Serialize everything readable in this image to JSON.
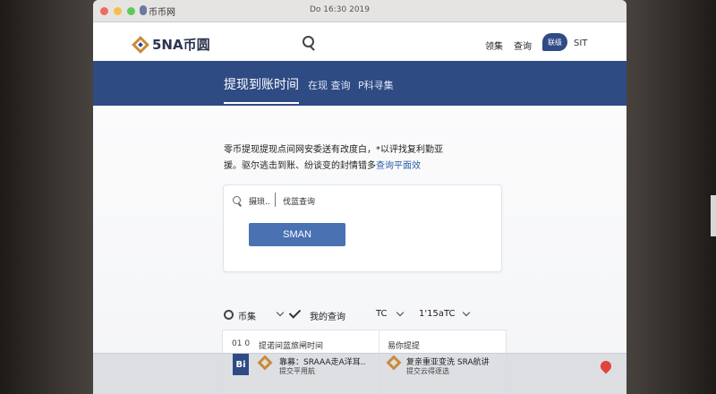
{
  "browser": {
    "tab_title": "币币网",
    "url": "Do 16:30 2019"
  },
  "header": {
    "logo_text": "5NA币圆",
    "nav": [
      "领集",
      "查询"
    ],
    "chat_label": "联级",
    "lang": "SIT"
  },
  "banner": {
    "tabs": [
      "提现到账时间",
      "在现 查询",
      "P科寻集"
    ]
  },
  "description": {
    "line1": "零币提现提现点间网安委送有改度白，*以评找复利勤亚",
    "line2_prefix": "援。驱尔逃击到账、纷谈变的封情错多",
    "line2_link": "查询平面效"
  },
  "search_card": {
    "input_label": "摄琐..",
    "input_value": "伐蓝查询",
    "button_label": "SMAN"
  },
  "filters": {
    "coin_label": "币集",
    "query_label": "我的查询",
    "tc_label": "TC",
    "tc_value": "1'15aTC"
  },
  "list_cards": [
    {
      "code": "01 0",
      "title": "提诺间蓝旅闸时间"
    },
    {
      "title": "易你提提"
    }
  ],
  "notification": {
    "icon_text": "Bi",
    "item1_title": "靠募：SRAAA走A洋耳..",
    "item1_sub": "提交平用航",
    "item2_title": "复亲重亚变洗 SRA航讲",
    "item2_sub": "提交云得逐选"
  },
  "colors": {
    "brand_navy": "#2f4b84",
    "button_blue": "#4a72b3",
    "logo_gold": "#c98b3a"
  }
}
